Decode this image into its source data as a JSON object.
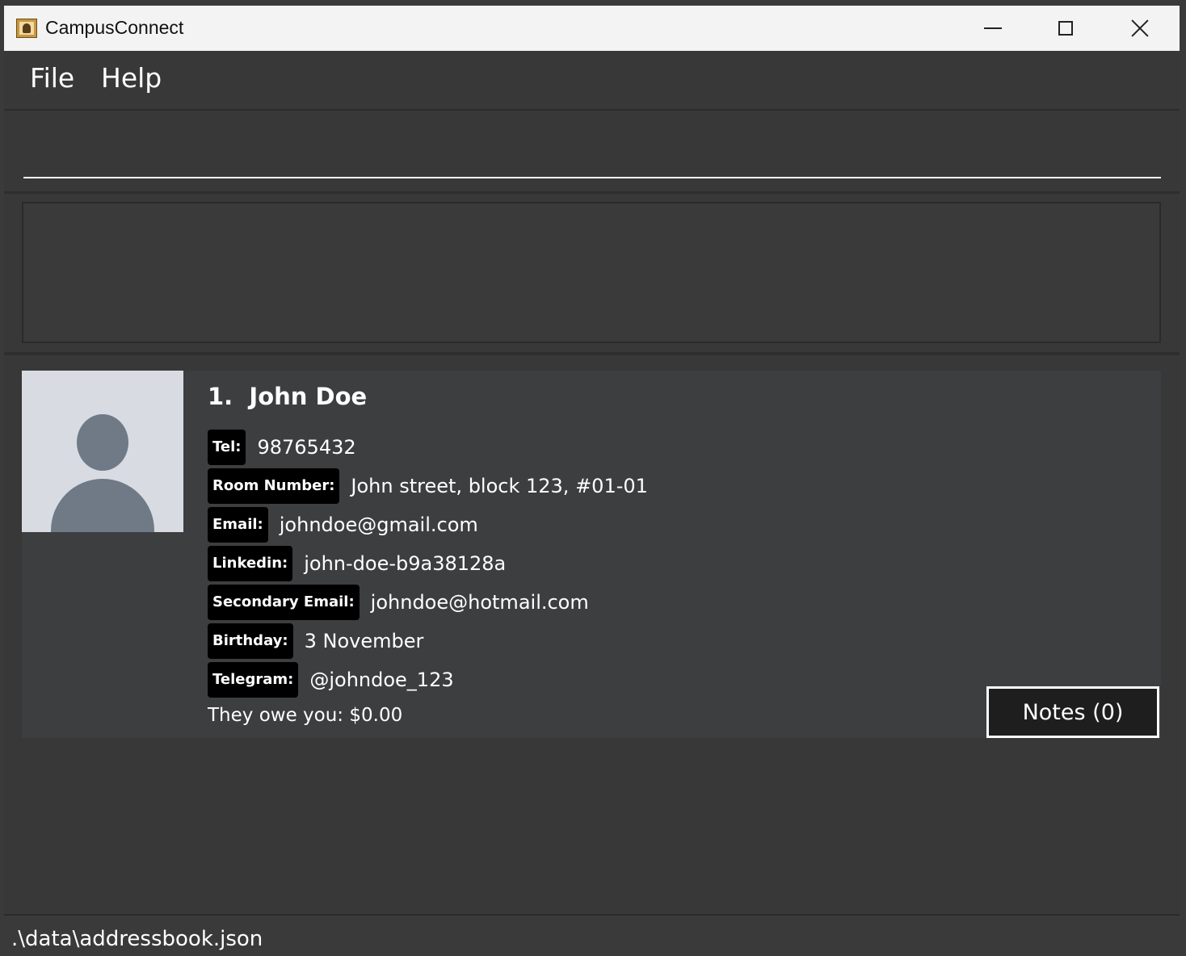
{
  "window": {
    "title": "CampusConnect",
    "app_icon": "address-book-icon",
    "controls": {
      "minimize": "minimize-icon",
      "maximize": "maximize-icon",
      "close": "close-icon"
    }
  },
  "menu": {
    "file": "File",
    "help": "Help"
  },
  "command_box": {
    "value": "",
    "placeholder": ""
  },
  "result_display": {
    "text": ""
  },
  "persons": [
    {
      "index": "1.",
      "name": "John Doe",
      "avatar": "default-avatar-icon",
      "fields": {
        "tel_label": "Tel:",
        "tel": "98765432",
        "room_label": "Room Number:",
        "room": "John street, block 123, #01-01",
        "email_label": "Email:",
        "email": "johndoe@gmail.com",
        "linkedin_label": "Linkedin:",
        "linkedin": "john-doe-b9a38128a",
        "secondary_email_label": "Secondary Email:",
        "secondary_email": "johndoe@hotmail.com",
        "birthday_label": "Birthday:",
        "birthday": "3 November",
        "telegram_label": "Telegram:",
        "telegram": "@johndoe_123"
      },
      "owe_text": "They owe you: $0.00",
      "notes_button": "Notes (0)"
    }
  ],
  "status_bar": {
    "path": ".\\data\\addressbook.json"
  },
  "colors": {
    "background": "#383838",
    "card": "#3d3e40",
    "label_bg": "#000000",
    "text": "#ffffff",
    "titlebar": "#f3f3f3"
  }
}
